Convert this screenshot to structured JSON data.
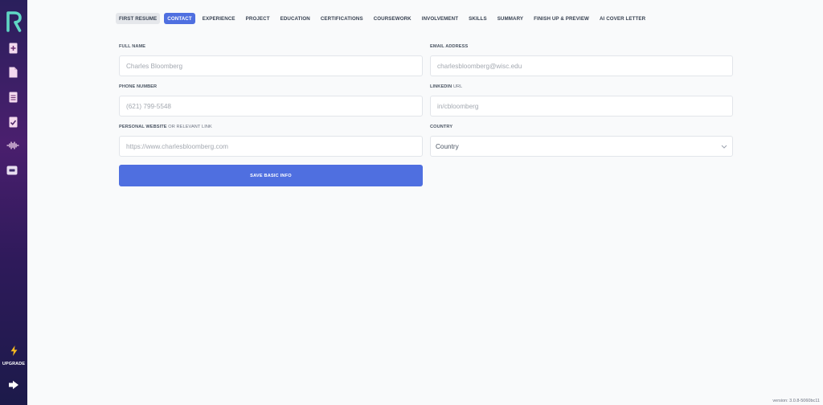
{
  "sidebar": {
    "items": [
      {
        "icon": "add-document-icon"
      },
      {
        "icon": "document-icon"
      },
      {
        "icon": "document-lines-icon"
      },
      {
        "icon": "document-check-icon"
      },
      {
        "icon": "audio-wave-icon"
      },
      {
        "icon": "chat-icon"
      }
    ],
    "upgrade_label": "UPGRADE",
    "logout_icon": "logout-icon"
  },
  "tabs": [
    {
      "label": "FIRST RESUME"
    },
    {
      "label": "CONTACT"
    },
    {
      "label": "EXPERIENCE"
    },
    {
      "label": "PROJECT"
    },
    {
      "label": "EDUCATION"
    },
    {
      "label": "CERTIFICATIONS"
    },
    {
      "label": "COURSEWORK"
    },
    {
      "label": "INVOLVEMENT"
    },
    {
      "label": "SKILLS"
    },
    {
      "label": "SUMMARY"
    },
    {
      "label": "FINISH UP & PREVIEW"
    },
    {
      "label": "AI COVER LETTER"
    }
  ],
  "form": {
    "full_name": {
      "label": "FULL NAME",
      "placeholder": "Charles Bloomberg"
    },
    "email": {
      "label": "EMAIL ADDRESS",
      "placeholder": "charlesbloomberg@wisc.edu"
    },
    "phone": {
      "label": "PHONE NUMBER",
      "placeholder": "(621) 799-5548"
    },
    "linkedin": {
      "label": "LINKEDIN",
      "label_suffix": "URL",
      "placeholder": "in/cbloomberg"
    },
    "website": {
      "label": "PERSONAL WEBSITE",
      "label_suffix": "OR RELEVANT LINK",
      "placeholder": "https://www.charlesbloomberg.com"
    },
    "country": {
      "label": "COUNTRY",
      "value": "Country"
    },
    "save_label": "SAVE BASIC INFO"
  },
  "version": "version: 3.0.8-5060bc11",
  "colors": {
    "accent": "#4f6fe0",
    "sidebar_top": "#2a1f5c",
    "logo_teal": "#5fd6c4"
  }
}
